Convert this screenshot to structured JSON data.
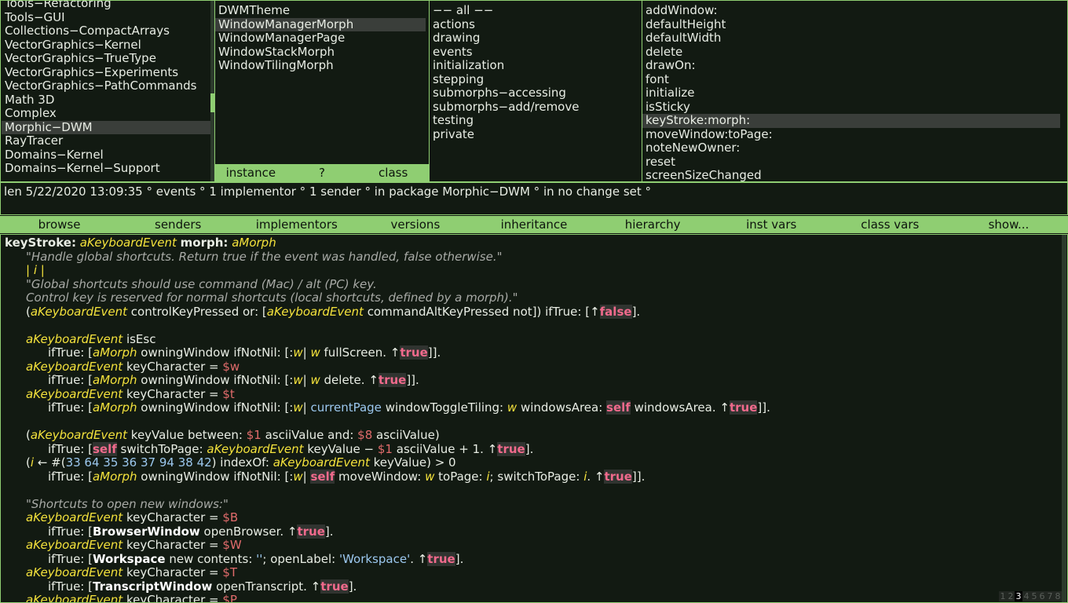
{
  "categories": [
    "Tools−Refactoring",
    "Tools−GUI",
    "Collections−CompactArrays",
    "VectorGraphics−Kernel",
    "VectorGraphics−TrueType",
    "VectorGraphics−Experiments",
    "VectorGraphics−PathCommands",
    "Math 3D",
    "Complex",
    "Morphic−DWM",
    "RayTracer",
    "Domains−Kernel",
    "Domains−Kernel−Support"
  ],
  "categories_selected": "Morphic−DWM",
  "classes": [
    "DWMTheme",
    "WindowManagerMorph",
    "WindowManagerPage",
    "WindowStackMorph",
    "WindowTilingMorph"
  ],
  "class_switch": {
    "instance": "instance",
    "query": "?",
    "class": "class"
  },
  "protocols": [
    "−− all −−",
    "actions",
    "drawing",
    "events",
    "initialization",
    "stepping",
    "submorphs−accessing",
    "submorphs−add/remove",
    "testing",
    "private"
  ],
  "selectors": [
    "addWindow:",
    "defaultHeight",
    "defaultWidth",
    "delete",
    "drawOn:",
    "font",
    "initialize",
    "isSticky",
    "keyStroke:morph:",
    "moveWindow:toPage:",
    "noteNewOwner:",
    "reset",
    "screenSizeChanged"
  ],
  "annotation": "len 5/22/2020 13:09:35 ° events ° 1 implementor ° 1 sender ° in package Morphic−DWM ° in no change set °",
  "buttons": [
    "browse",
    "senders",
    "implementors",
    "versions",
    "inheritance",
    "hierarchy",
    "inst vars",
    "class vars",
    "show..."
  ],
  "code": {
    "sel1": "keyStroke:",
    "arg1": "aKeyboardEvent",
    "sel2": "morph:",
    "arg2": "aMorph",
    "c1": "\"Handle global shortcuts. Return true if the event was handled, false otherwise.\"",
    "temps": "| i |",
    "c2": "\"Global shortcuts should use command (Mac) / alt (PC) key.",
    "c3": "Control key is reserved for normal shortcuts (local shortcuts, defined by a morph).\"",
    "ev": "aKeyboardEvent",
    "mo": "aMorph",
    "w": "w",
    "i": "i",
    "ctl": "controlKeyPressed or: [",
    "cmd": "commandAltKeyPressed not]) ifTrue: [↑",
    "f": "false",
    "t": "true",
    "s": "self",
    "isEsc": "isEsc",
    "own": "owningWindow ifNotNil: [:",
    "full": "fullScreen. ↑",
    "del": "delete. ↑",
    "kc": "keyCharacter = ",
    "cw": "$w",
    "ct": "$t",
    "cB": "$B",
    "cW": "$W",
    "cT": "$T",
    "cP": "$P",
    "cp": "currentPage",
    "wtt": "windowToggleTiling:",
    "wa": "windowsArea:",
    "wa2": "windowsArea. ↑",
    "kv": "keyValue between: ",
    "c1c": "$1",
    "c8c": "$8",
    "av": "asciiValue and: ",
    "av2": "asciiValue)",
    "stp": "switchToPage:",
    "kv2": "keyValue − ",
    "av3": "asciiValue + 1. ↑",
    "arr": "← #(",
    "nums": "33 64 35 36 37 94 38 42",
    "io": ") indexOf: ",
    "kv3": "keyValue) > 0",
    "mw": "moveWindow:",
    "tp": "toPage:",
    "stp2": "switchToPage:",
    "c4": "\"Shortcuts to open new windows:\"",
    "bw": "BrowserWindow",
    "ob": "openBrowser. ↑",
    "ws": "Workspace",
    "nc": "new contents: ",
    "es": "''",
    "ol": "; openLabel: ",
    "wss": "'Workspace'",
    "tw": "TranscriptWindow",
    "ot": "openTranscript. ↑",
    "ift": "ifTrue: ["
  },
  "taskbar": [
    "1",
    "2",
    "3",
    "4",
    "5",
    "6",
    "7",
    "8"
  ],
  "taskbar_current": "3",
  "accent_color": "#8fce72"
}
